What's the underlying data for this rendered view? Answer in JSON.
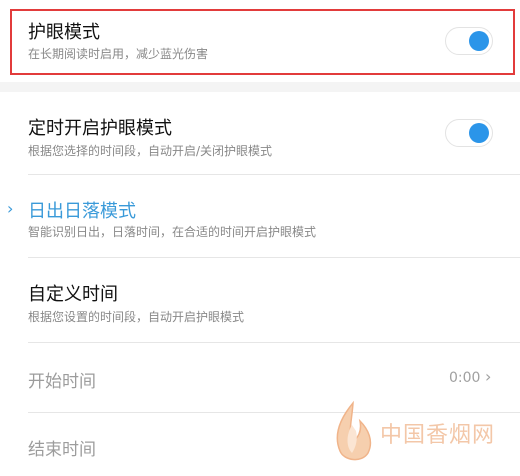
{
  "eye_care": {
    "title": "护眼模式",
    "subtitle": "在长期阅读时启用，减少蓝光伤害",
    "enabled": true
  },
  "scheduled": {
    "title": "定时开启护眼模式",
    "subtitle": "根据您选择的时间段，自动开启/关闭护眼模式",
    "enabled": true
  },
  "sunrise_sunset": {
    "title": "日出日落模式",
    "subtitle": "智能识别日出，日落时间，在合适的时间开启护眼模式",
    "chevron_icon": "chevron-right-icon",
    "accent_color": "#3a9ad9"
  },
  "custom_time": {
    "title": "自定义时间",
    "subtitle": "根据您设置的时间段，自动开启护眼模式"
  },
  "start_time": {
    "label": "开始时间",
    "value": "0:00",
    "arrow_icon": "chevron-right-icon"
  },
  "end_time": {
    "label": "结束时间"
  },
  "watermark": {
    "text": "中国香烟网",
    "icon": "flame-logo-icon"
  },
  "highlight_color": "#e23b3b",
  "toggle_color": "#2b95e9"
}
